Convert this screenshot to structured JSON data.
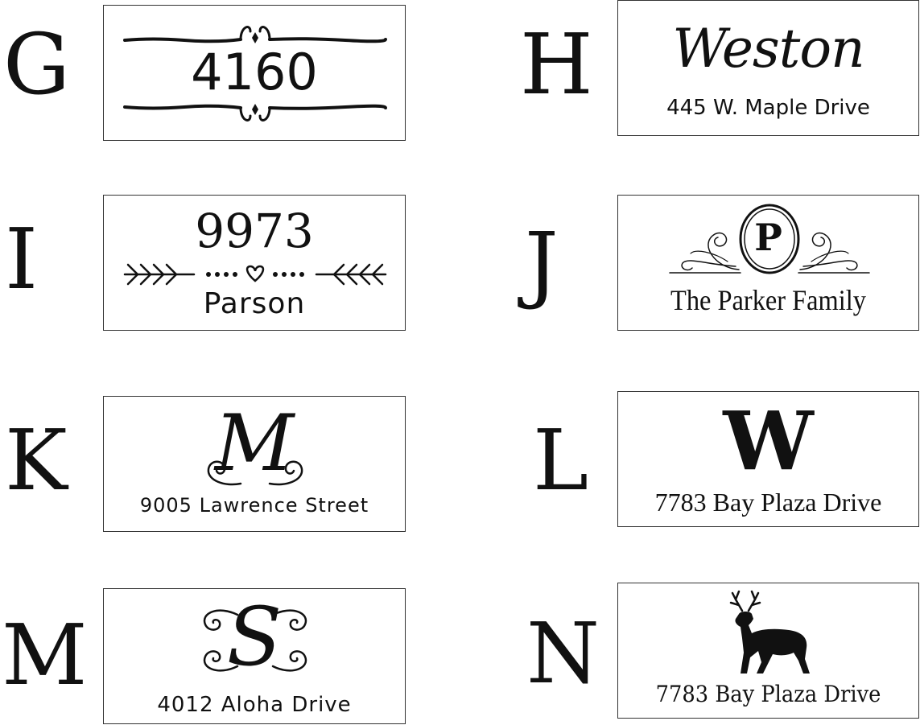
{
  "designs": [
    {
      "letter": "G",
      "lines": [
        "4160"
      ]
    },
    {
      "letter": "H",
      "lines": [
        "Weston",
        "445 W. Maple Drive"
      ]
    },
    {
      "letter": "I",
      "lines": [
        "9973",
        "Parson"
      ]
    },
    {
      "letter": "J",
      "lines": [
        "P",
        "The Parker Family"
      ]
    },
    {
      "letter": "K",
      "lines": [
        "M",
        "9005 Lawrence Street"
      ]
    },
    {
      "letter": "L",
      "lines": [
        "W",
        "7783 Bay Plaza Drive"
      ]
    },
    {
      "letter": "M",
      "lines": [
        "S",
        "4012 Aloha Drive"
      ]
    },
    {
      "letter": "N",
      "lines": [
        "7783 Bay Plaza Drive"
      ]
    }
  ],
  "colors": {
    "ink": "#111111",
    "border": "#333333",
    "background": "#ffffff"
  },
  "icons": {
    "G": "scroll-divider-icon",
    "I": "arrow-heart-divider-icon",
    "J": "oval-crest-flourish-icon",
    "K": "curl-flourish-icon",
    "M": "swirl-flourish-icon",
    "N": "deer-icon"
  }
}
